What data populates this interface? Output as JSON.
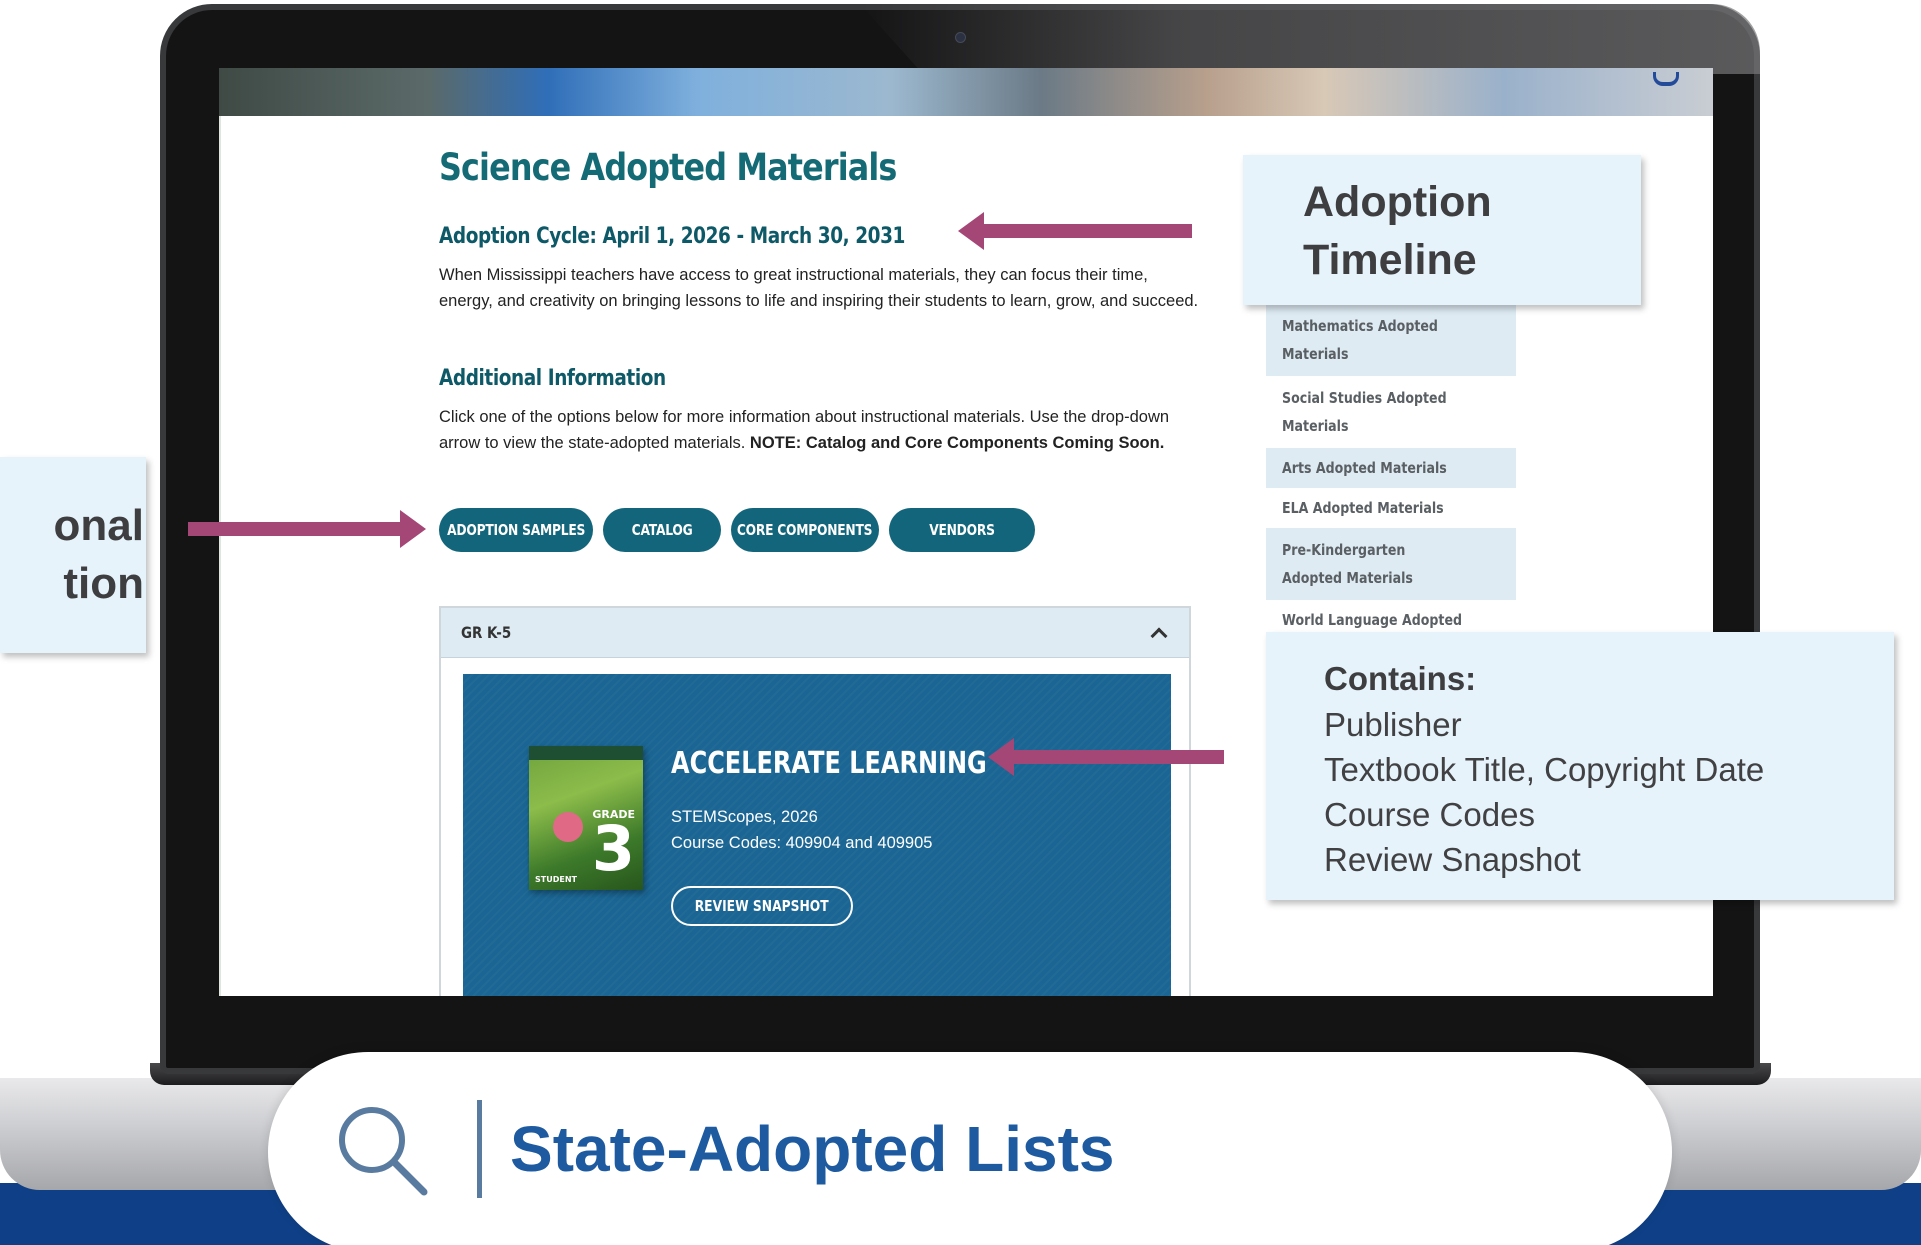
{
  "page": {
    "title": "Science Adopted Materials",
    "cycle": "Adoption Cycle: April 1, 2026 - March 30, 2031",
    "intro": "When Mississippi teachers have access to great instructional materials, they can focus their time, energy, and creativity on bringing lessons to life and inspiring their students to learn, grow, and succeed.",
    "additional_heading": "Additional Information",
    "additional_text": "Click one of the options below for more information about instructional materials. Use the drop-down arrow to view the state-adopted materials.",
    "note_label": "NOTE:",
    "note_text": "Catalog and Core Components Coming Soon."
  },
  "buttons": {
    "adoption_samples": "ADOPTION SAMPLES",
    "catalog": "CATALOG",
    "core_components": "CORE COMPONENTS",
    "vendors": "VENDORS"
  },
  "accordion": {
    "title": "GR K-5",
    "card": {
      "title": "ACCELERATE LEARNING",
      "publisher_line": "STEMScopes, 2026",
      "codes_line": "Course Codes: 409904 and 409905",
      "review_button": "REVIEW SNAPSHOT",
      "book_grade_label": "GRADE",
      "book_grade_number": "3",
      "book_student_label": "STUDENT"
    }
  },
  "sidebar": {
    "items": [
      "Mathematics Adopted Materials",
      "Social Studies Adopted Materials",
      "Arts Adopted Materials",
      "ELA Adopted Materials",
      "Pre-Kindergarten Adopted Materials",
      "World Language Adopted"
    ]
  },
  "callouts": {
    "timeline_line1": "Adoption",
    "timeline_line2": "Timeline",
    "left_line1": "onal",
    "left_line2": "tion",
    "contains_heading": "Contains:",
    "contains_items": [
      "Publisher",
      "Textbook Title, Copyright Date",
      "Course Codes",
      "Review Snapshot"
    ]
  },
  "search": {
    "label": "State-Adopted Lists",
    "icon": "search-icon"
  },
  "colors": {
    "teal_heading": "#146a75",
    "button_teal": "#12657a",
    "card_blue": "#1a6593",
    "arrow_magenta": "#a44676",
    "callout_bg": "#e6f3fb",
    "band_blue": "#0f3f86",
    "search_text": "#1e5aa0"
  }
}
